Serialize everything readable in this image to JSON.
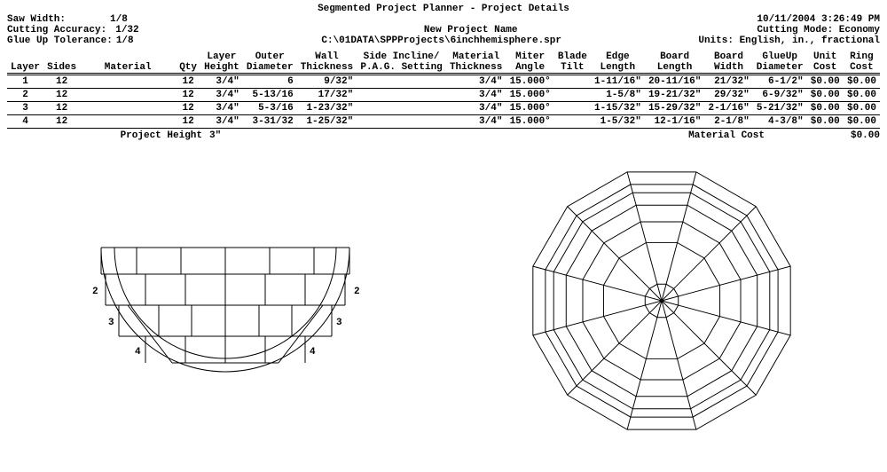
{
  "title": "Segmented Project Planner - Project Details",
  "datetime": "10/11/2004 3:26:49 PM",
  "cutting_mode": "Cutting Mode: Economy",
  "units": "Units: English, in., fractional",
  "left_params": {
    "saw_width_label": "Saw Width:",
    "saw_width_value": "1/8",
    "cutting_accuracy_label": "Cutting Accuracy:",
    "cutting_accuracy_value": "1/32",
    "glue_up_tol_label": "Glue Up Tolerance:",
    "glue_up_tol_value": "1/8"
  },
  "project_name": "New Project Name",
  "project_path": "C:\\01DATA\\SPPProjects\\6inchhemisphere.spr",
  "columns": {
    "layer": "Layer",
    "sides": "Sides",
    "material": "Material",
    "qty": "Qty",
    "layer_height": "Layer\nHeight",
    "outer_dia": "Outer\nDiameter",
    "wall_thk": "Wall\nThickness",
    "side_incline": "Side Incline/\nP.A.G. Setting",
    "mat_thk": "Material\nThickness",
    "miter_angle": "Miter\nAngle",
    "blade_tilt": "Blade\nTilt",
    "edge_len": "Edge\nLength",
    "board_len": "Board\nLength",
    "board_wid": "Board\nWidth",
    "glueup_dia": "GlueUp\nDiameter",
    "unit_cost": "Unit\nCost",
    "ring_cost": "Ring\nCost"
  },
  "rows": [
    {
      "layer": "1",
      "sides": "12",
      "material": "",
      "qty": "12",
      "layer_height": "3/4\"",
      "outer_dia": "6",
      "wall_thk": "9/32\"",
      "side_incline": "",
      "mat_thk": "3/4\"",
      "miter_angle": "15.000°",
      "blade_tilt": "",
      "edge_len": "1-11/16\"",
      "board_len": "20-11/16\"",
      "board_wid": "21/32\"",
      "glueup_dia": "6-1/2\"",
      "unit_cost": "$0.00",
      "ring_cost": "$0.00"
    },
    {
      "layer": "2",
      "sides": "12",
      "material": "",
      "qty": "12",
      "layer_height": "3/4\"",
      "outer_dia": "5-13/16",
      "wall_thk": "17/32\"",
      "side_incline": "",
      "mat_thk": "3/4\"",
      "miter_angle": "15.000°",
      "blade_tilt": "",
      "edge_len": "1-5/8\"",
      "board_len": "19-21/32\"",
      "board_wid": "29/32\"",
      "glueup_dia": "6-9/32\"",
      "unit_cost": "$0.00",
      "ring_cost": "$0.00"
    },
    {
      "layer": "3",
      "sides": "12",
      "material": "",
      "qty": "12",
      "layer_height": "3/4\"",
      "outer_dia": "5-3/16",
      "wall_thk": "1-23/32\"",
      "side_incline": "",
      "mat_thk": "3/4\"",
      "miter_angle": "15.000°",
      "blade_tilt": "",
      "edge_len": "1-15/32\"",
      "board_len": "15-29/32\"",
      "board_wid": "2-1/16\"",
      "glueup_dia": "5-21/32\"",
      "unit_cost": "$0.00",
      "ring_cost": "$0.00"
    },
    {
      "layer": "4",
      "sides": "12",
      "material": "",
      "qty": "12",
      "layer_height": "3/4\"",
      "outer_dia": "3-31/32",
      "wall_thk": "1-25/32\"",
      "side_incline": "",
      "mat_thk": "3/4\"",
      "miter_angle": "15.000°",
      "blade_tilt": "",
      "edge_len": "1-5/32\"",
      "board_len": "12-1/16\"",
      "board_wid": "2-1/8\"",
      "glueup_dia": "4-3/8\"",
      "unit_cost": "$0.00",
      "ring_cost": "$0.00"
    }
  ],
  "footer": {
    "project_height_label": "Project Height",
    "project_height_value": "3\"",
    "material_cost_label": "Material Cost",
    "material_cost_value": "$0.00"
  }
}
